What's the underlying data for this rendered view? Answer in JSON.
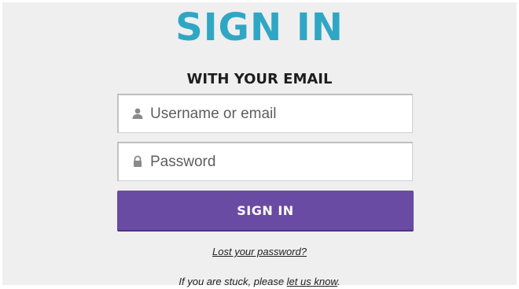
{
  "heading": {
    "title": "SIGN IN",
    "subtitle": "WITH YOUR EMAIL"
  },
  "form": {
    "username": {
      "placeholder": "Username or email",
      "value": "",
      "icon": "user-icon"
    },
    "password": {
      "placeholder": "Password",
      "value": "",
      "icon": "lock-icon"
    },
    "submit_label": "SIGN IN"
  },
  "links": {
    "lost_password": "Lost your password?",
    "help_prefix": "If you are stuck, please ",
    "help_link": "let us know",
    "help_suffix": "."
  },
  "colors": {
    "title": "#2fa7c4",
    "button": "#6a4ba3",
    "background": "#efefef"
  }
}
